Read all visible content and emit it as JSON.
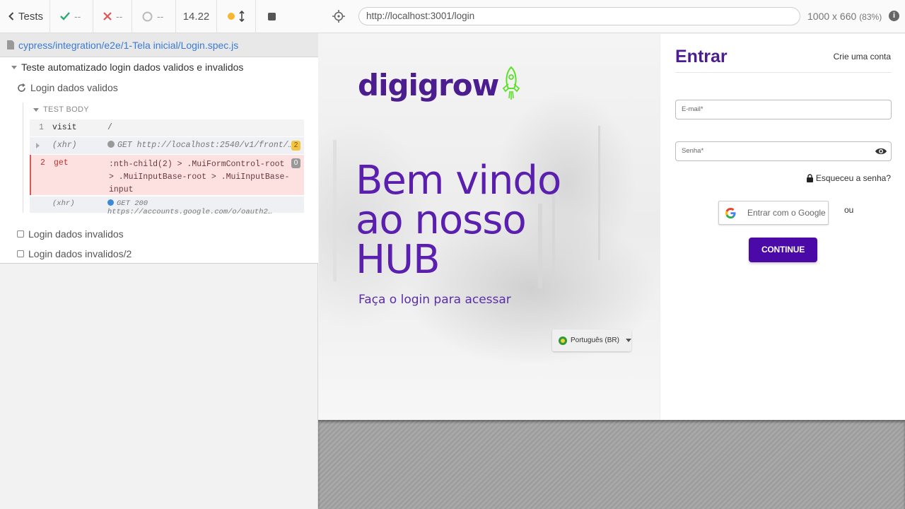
{
  "runner": {
    "tests_label": "Tests",
    "passed": "--",
    "failed": "--",
    "pending": "--",
    "duration": "14.22",
    "spec_path": "cypress/integration/e2e/1-Tela inicial/Login.spec.js"
  },
  "reporter": {
    "suite_title": "Teste automatizado login dados validos e invalidos",
    "tests": [
      {
        "title": "Login dados validos",
        "state": "running"
      },
      {
        "title": "Login dados invalidos",
        "state": "pending"
      },
      {
        "title": "Login dados invalidos/2",
        "state": "pending"
      }
    ],
    "test_body_label": "TEST BODY",
    "commands": [
      {
        "num": "1",
        "name": "visit",
        "message": "/"
      },
      {
        "num": "",
        "name": "(xhr)",
        "message": "GET http://localhost:2540/v1/front/…",
        "badge": "2",
        "dot_color": "#999999"
      },
      {
        "num": "2",
        "name": "get",
        "message": ":nth-child(2) > .MuiFormControl-root > .MuiInputBase-root > .MuiInputBase-input",
        "badge": "0"
      },
      {
        "num": "",
        "name": "(xhr)",
        "message": "GET 200 https://accounts.google.com/o/oauth2…",
        "dot_color": "#3a8ad8"
      }
    ]
  },
  "aut": {
    "url": "http://localhost:3001/login",
    "viewport": "1000 x 660",
    "scale": "(83%)"
  },
  "page": {
    "logo_text": "digigrow",
    "welcome_lines": [
      "Bem vindo",
      "ao nosso",
      "HUB"
    ],
    "subtitle": "Faça o login para acessar",
    "language": "Português (BR)",
    "login_title": "Entrar",
    "create_account": "Crie uma conta",
    "email_placeholder": "E-mail*",
    "password_placeholder": "Senha*",
    "forgot_password": "Esqueceu a senha?",
    "google_button": "Entrar com o Google",
    "or_label": "ou",
    "continue_button": "CONTINUE"
  },
  "colors": {
    "brand_purple": "#4b1d8e",
    "button_purple": "#4b0aa8",
    "pass_green": "#2aa876",
    "fail_red": "#e05555"
  }
}
